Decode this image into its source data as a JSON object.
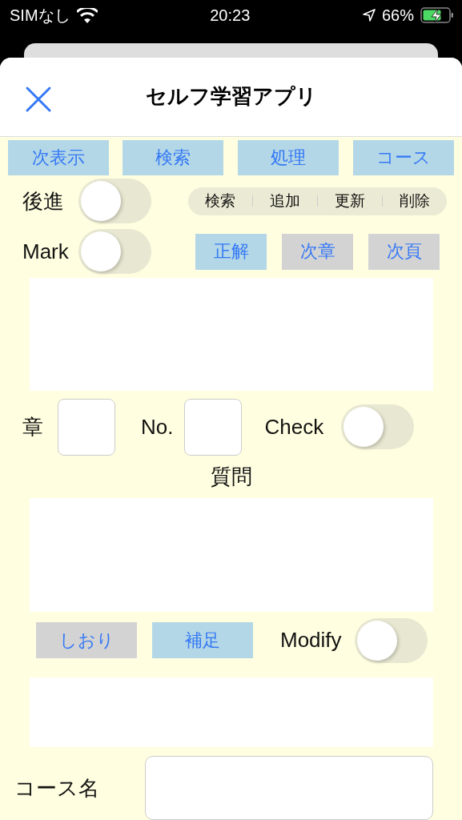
{
  "status_bar": {
    "carrier": "SIMなし",
    "time": "20:23",
    "battery": "66%"
  },
  "nav": {
    "title": "セルフ学習アプリ"
  },
  "top_buttons": [
    {
      "label": "次表示",
      "color": "#b3d7e6"
    },
    {
      "label": "検索",
      "color": "#b3d7e6"
    },
    {
      "label": "処理",
      "color": "#b3d7e6"
    },
    {
      "label": "コース",
      "color": "#b3d7e6"
    }
  ],
  "reverse": {
    "label": "後進",
    "on": false
  },
  "segments": [
    {
      "label": "検索",
      "selected": false
    },
    {
      "label": "追加",
      "selected": false
    },
    {
      "label": "更新",
      "selected": false
    },
    {
      "label": "削除",
      "selected": false
    }
  ],
  "mark": {
    "label": "Mark",
    "on": false
  },
  "answer_buttons": [
    {
      "label": "正解",
      "color": "#b3d7e6"
    },
    {
      "label": "次章",
      "color": "#d3d3d3"
    },
    {
      "label": "次頁",
      "color": "#d3d3d3"
    }
  ],
  "chapter": {
    "label": "章"
  },
  "number": {
    "label": "No."
  },
  "check": {
    "label": "Check",
    "on": false
  },
  "question": {
    "label": "質問"
  },
  "bookmark_buttons": [
    {
      "label": "しおり",
      "color": "#d3d3d3"
    },
    {
      "label": "補足",
      "color": "#b3d7e6"
    }
  ],
  "modify": {
    "label": "Modify",
    "on": false
  },
  "course": {
    "label": "コース名"
  }
}
